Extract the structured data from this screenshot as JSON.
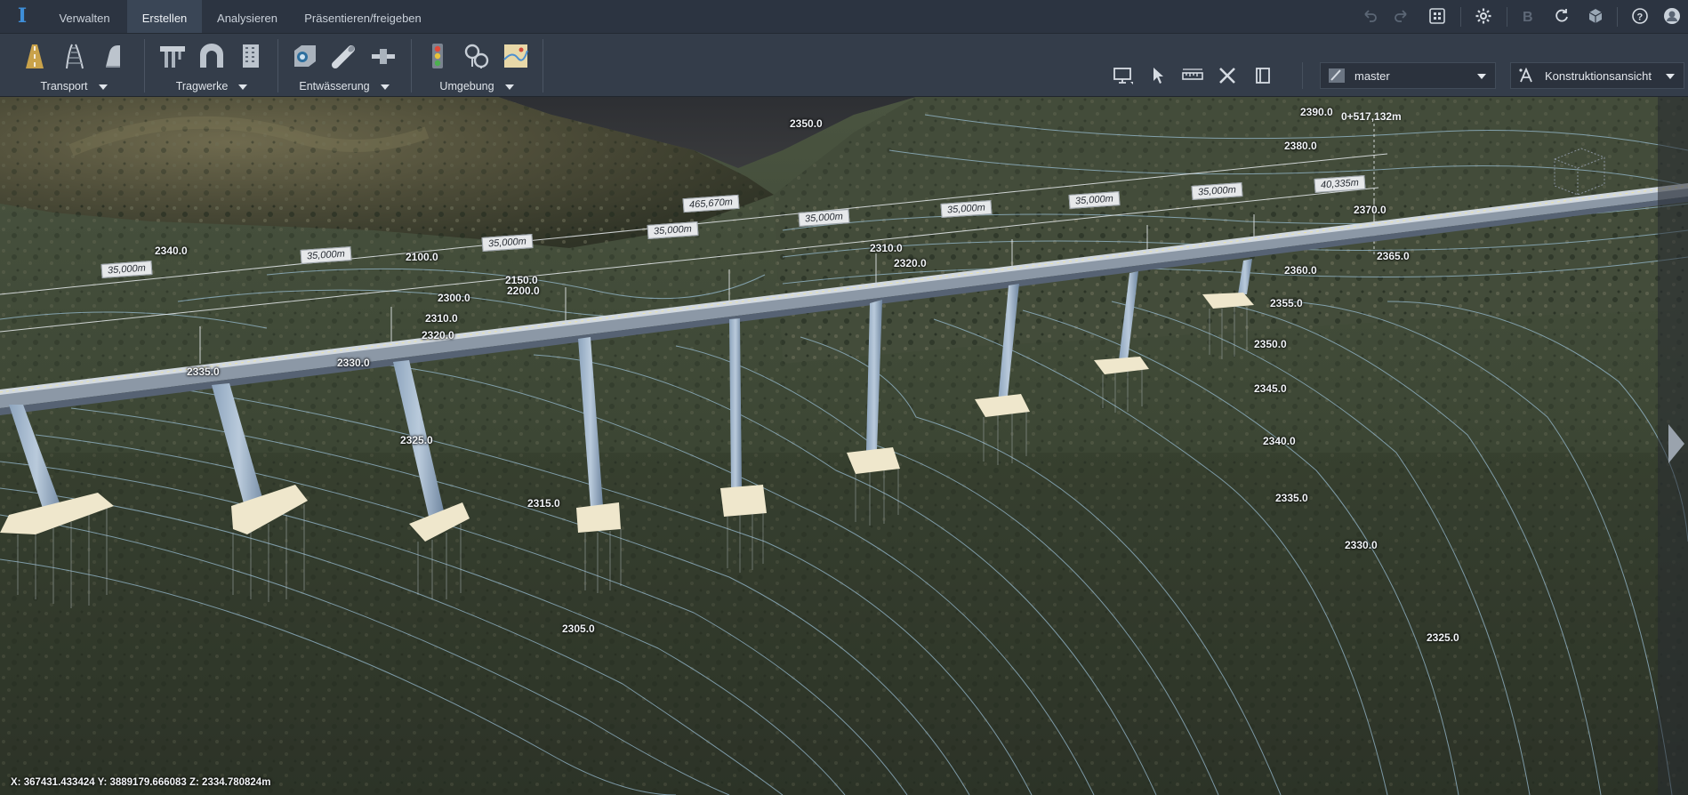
{
  "tabs": [
    {
      "label": "Verwalten"
    },
    {
      "label": "Erstellen"
    },
    {
      "label": "Analysieren"
    },
    {
      "label": "Präsentieren/freigeben"
    }
  ],
  "active_tab": "Erstellen",
  "ribbon": {
    "groups": [
      {
        "label": "Transport",
        "icons": [
          "road-icon",
          "railway-icon",
          "pavement-icon"
        ]
      },
      {
        "label": "Tragwerke",
        "icons": [
          "bridge-icon",
          "tunnel-icon",
          "building-icon"
        ]
      },
      {
        "label": "Entwässerung",
        "icons": [
          "drainage-box-icon",
          "pipe-icon",
          "culvert-icon"
        ]
      },
      {
        "label": "Umgebung",
        "icons": [
          "traffic-light-icon",
          "vegetation-icon",
          "terrain-icon"
        ]
      }
    ]
  },
  "toolbar_right": {
    "proposal": "master",
    "view": "Konstruktionsansicht"
  },
  "viewport": {
    "station": "0+517,132m",
    "coordinates": "X: 367431.433424 Y: 3889179.666083 Z: 2334.780824m",
    "dimensions": {
      "total": "465,670m",
      "spans": [
        "35,000m",
        "35,000m",
        "35,000m",
        "35,000m",
        "35,000m",
        "35,000m",
        "35,000m",
        "35,000m",
        "35,000m",
        "40,335m"
      ]
    },
    "contours": [
      "2350.0",
      "2390.0",
      "2380.0",
      "2370.0",
      "2340.0",
      "2100.0",
      "2150.0",
      "2200.0",
      "2300.0",
      "2310.0",
      "2320.0",
      "2330.0",
      "2335.0",
      "2325.0",
      "2315.0",
      "2310.0",
      "2320.0",
      "2365.0",
      "2360.0",
      "2355.0",
      "2350.0",
      "2345.0",
      "2340.0",
      "2335.0",
      "2330.0",
      "2305.0",
      "2325.0"
    ]
  }
}
